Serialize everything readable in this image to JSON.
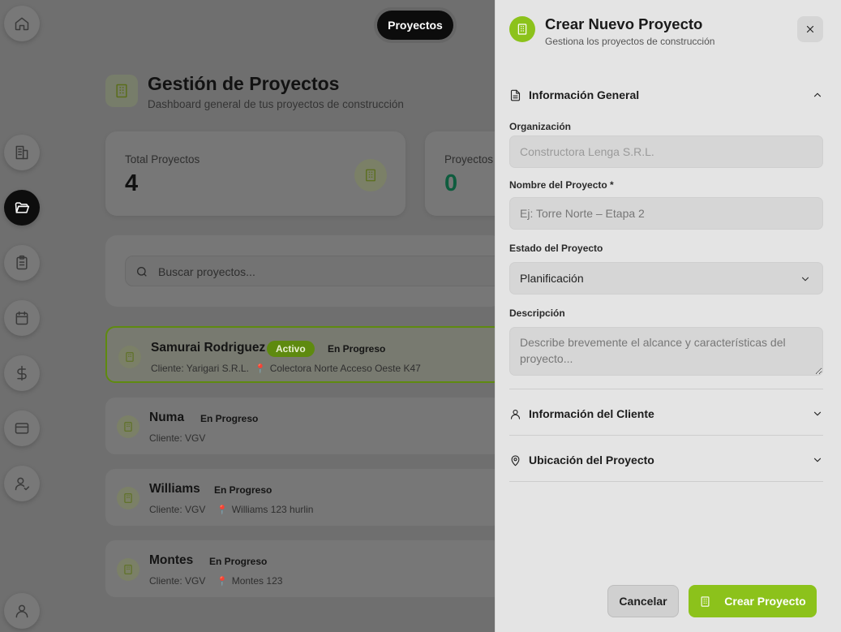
{
  "top_nav": {
    "active_pill": "Proyectos"
  },
  "header": {
    "title": "Gestión de Proyectos",
    "subtitle": "Dashboard general de tus proyectos de construcción"
  },
  "stats": [
    {
      "label": "Total Proyectos",
      "value": "4"
    },
    {
      "label": "Proyectos",
      "value": "0"
    }
  ],
  "search": {
    "placeholder": "Buscar proyectos..."
  },
  "projects": [
    {
      "name": "Samurai Rodriguez",
      "badge": "Activo",
      "status": "En Progreso",
      "client": "Cliente: Yarigari S.R.L.",
      "location": "Colectora Norte Acceso Oeste K47"
    },
    {
      "name": "Numa",
      "status": "En Progreso",
      "client": "Cliente: VGV",
      "location": ""
    },
    {
      "name": "Williams",
      "status": "En Progreso",
      "client": "Cliente: VGV",
      "location": "Williams 123 hurlin"
    },
    {
      "name": "Montes",
      "status": "En Progreso",
      "client": "Cliente: VGV",
      "location": "Montes 123"
    }
  ],
  "drawer": {
    "title": "Crear Nuevo Proyecto",
    "subtitle": "Gestiona los proyectos de construcción",
    "sections": {
      "general": "Información General",
      "client": "Información del Cliente",
      "location": "Ubicación del Proyecto"
    },
    "fields": {
      "org_label": "Organización",
      "org_value": "Constructora Lenga S.R.L.",
      "name_label": "Nombre del Proyecto *",
      "name_placeholder": "Ej: Torre Norte – Etapa 2",
      "status_label": "Estado del Proyecto",
      "status_value": "Planificación",
      "desc_label": "Descripción",
      "desc_placeholder": "Describe brevemente el alcance y características del proyecto..."
    },
    "buttons": {
      "cancel": "Cancelar",
      "create": "Crear Proyecto"
    }
  },
  "colors": {
    "accent": "#8cc21b",
    "overlay": "#6f6f6f",
    "drawer_bg": "#e4e4e4"
  }
}
